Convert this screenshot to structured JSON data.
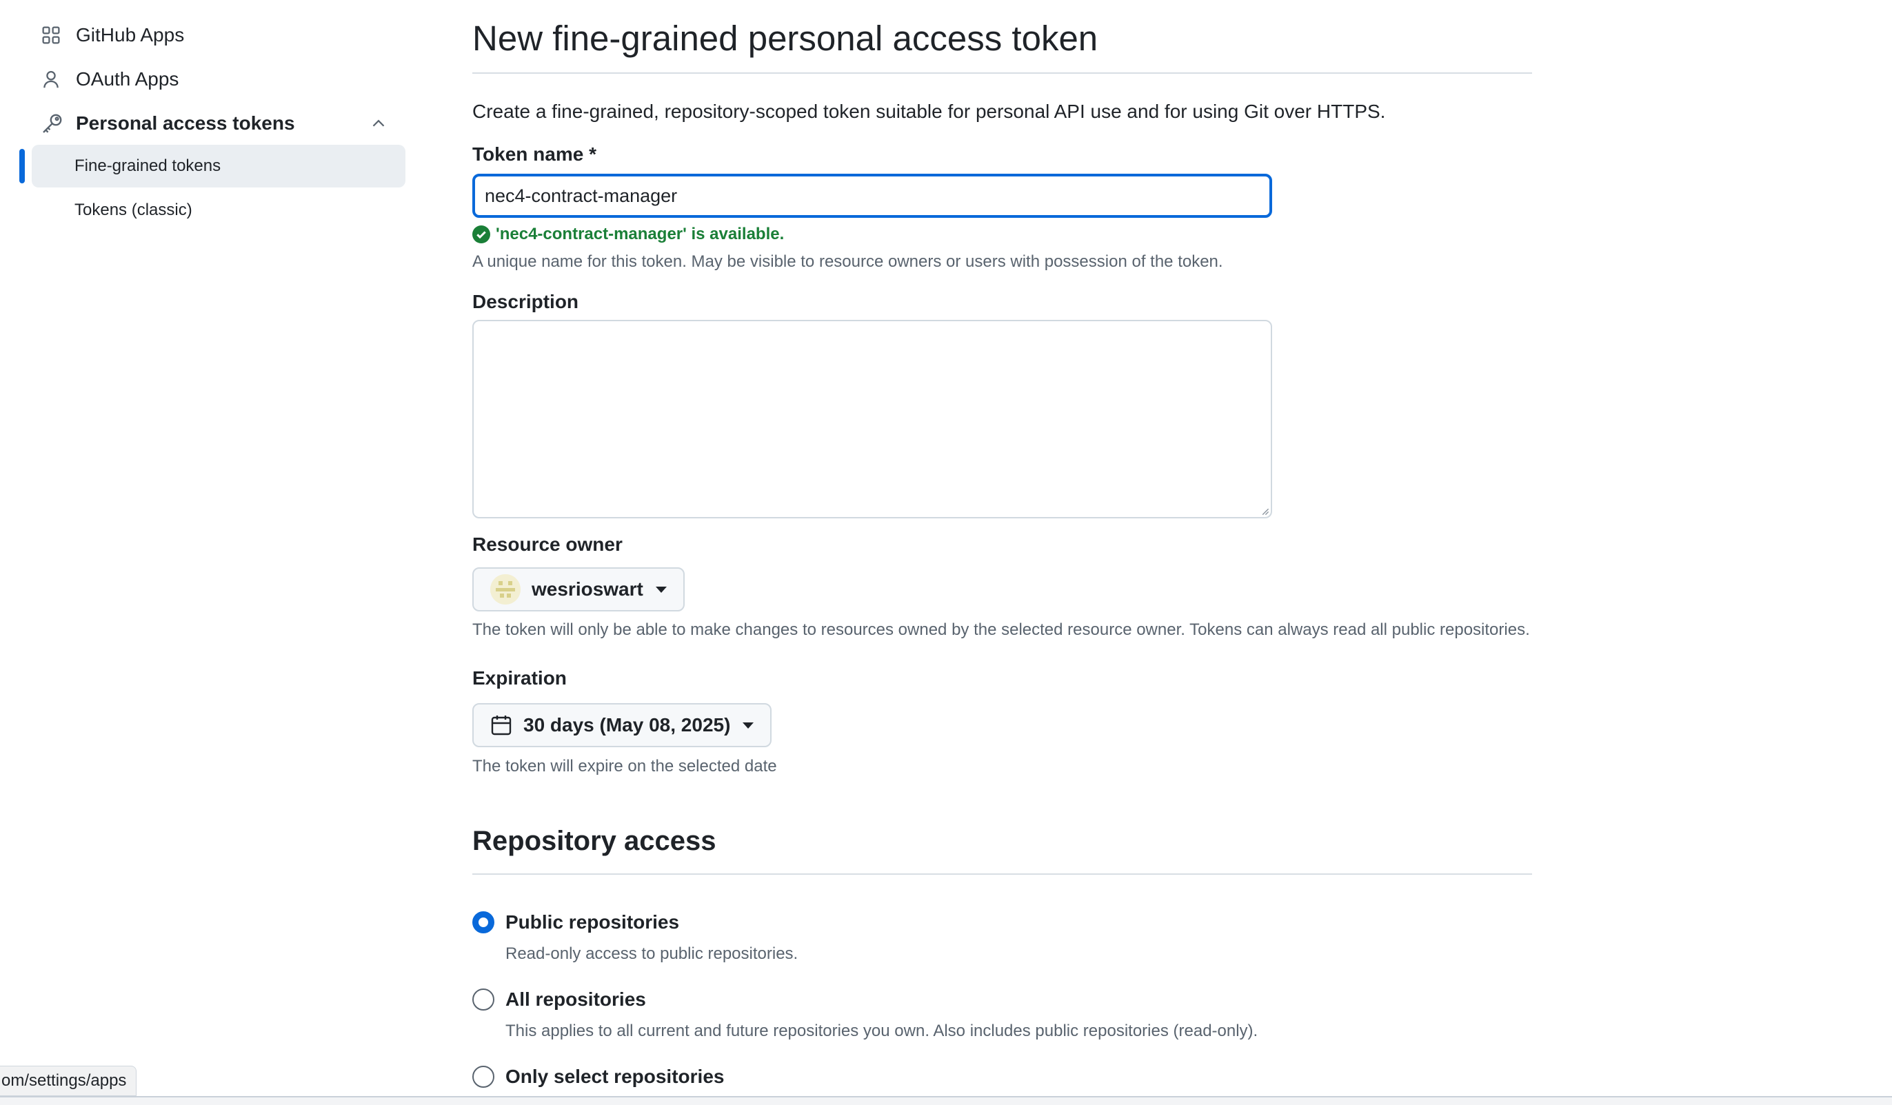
{
  "sidebar": {
    "items": [
      {
        "label": "GitHub Apps",
        "icon": "apps-grid-icon"
      },
      {
        "label": "OAuth Apps",
        "icon": "person-icon"
      },
      {
        "label": "Personal access tokens",
        "icon": "key-icon",
        "expanded": true
      }
    ],
    "sub_items": [
      {
        "label": "Fine-grained tokens",
        "active": true
      },
      {
        "label": "Tokens (classic)",
        "active": false
      }
    ]
  },
  "main": {
    "title": "New fine-grained personal access token",
    "intro": "Create a fine-grained, repository-scoped token suitable for personal API use and for using Git over HTTPS.",
    "token_name": {
      "label": "Token name *",
      "value": "nec4-contract-manager",
      "availability": "'nec4-contract-manager' is available.",
      "note": "A unique name for this token. May be visible to resource owners or users with possession of the token."
    },
    "description": {
      "label": "Description",
      "value": ""
    },
    "resource_owner": {
      "label": "Resource owner",
      "selected": "wesrioswart",
      "note": "The token will only be able to make changes to resources owned by the selected resource owner. Tokens can always read all public repositories."
    },
    "expiration": {
      "label": "Expiration",
      "selected": "30 days (May 08, 2025)",
      "note": "The token will expire on the selected date"
    },
    "repository_access": {
      "title": "Repository access",
      "options": [
        {
          "label": "Public repositories",
          "note": "Read-only access to public repositories.",
          "checked": true
        },
        {
          "label": "All repositories",
          "note": "This applies to all current and future repositories you own. Also includes public repositories (read-only).",
          "checked": false
        },
        {
          "label": "Only select repositories",
          "note": "",
          "checked": false
        }
      ]
    }
  },
  "status_bar": {
    "url": "om/settings/apps"
  },
  "colors": {
    "accent": "#0969da",
    "success": "#1a7f37",
    "muted": "#59636e",
    "border": "#d1d9e0"
  }
}
